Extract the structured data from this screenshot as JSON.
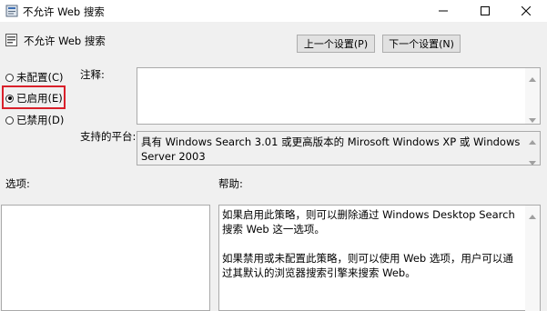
{
  "window": {
    "title": "不允许 Web 搜索",
    "icons": {
      "app": "policy-settings-icon",
      "minimize": "minimize-icon",
      "maximize": "maximize-icon",
      "close": "close-icon"
    }
  },
  "header": {
    "policy_name": "不允许 Web 搜索",
    "prev_label": "上一个设置(P)",
    "next_label": "下一个设置(N)"
  },
  "state": {
    "options": [
      {
        "label": "未配置(C)",
        "selected": false
      },
      {
        "label": "已启用(E)",
        "selected": true
      },
      {
        "label": "已禁用(D)",
        "selected": false
      }
    ],
    "highlight_color": "#d9202a"
  },
  "comment": {
    "label": "注释:",
    "value": ""
  },
  "supported": {
    "label": "支持的平台:",
    "value": "具有 Windows Search 3.01 或更高版本的 Mirosoft Windows XP 或 Windows Server 2003"
  },
  "options_section": {
    "label": "选项:"
  },
  "help": {
    "label": "帮助:",
    "paragraphs": [
      "如果启用此策略，则可以删除通过 Windows Desktop Search 搜索 Web 这一选项。",
      "如果禁用或未配置此策略，则可以使用 Web 选项，用户可以通过其默认的浏览器搜索引擎来搜索 Web。"
    ]
  }
}
